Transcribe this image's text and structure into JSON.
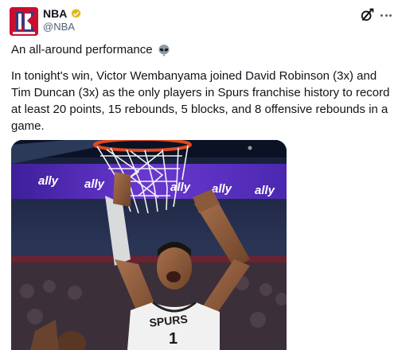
{
  "post": {
    "author": {
      "display_name": "NBA",
      "handle": "@NBA",
      "verified": true,
      "avatar_lettering": "NBA"
    },
    "text_line1": "An all-around performance",
    "text_body": "In tonight's win, Victor Wembanyama joined David Robinson (3x) and Tim Duncan (3x) as the only players in Spurs franchise history to record at least 20 points, 15 rebounds, 5 blocks, and 8 offensive rebounds in a game.",
    "emoji": "alien-icon",
    "media": {
      "jersey_text": "SPURS",
      "jersey_number": "1",
      "arena_banner_text": "ally"
    }
  },
  "icons": {
    "grok": "grok-icon",
    "more": "more-icon",
    "verified": "verified-badge-icon"
  },
  "colors": {
    "verified_gold": "#e2b719",
    "text_primary": "#0f1419",
    "text_secondary": "#536471",
    "avatar_red": "#c8102e",
    "arena_banner": "#5b2bb8"
  }
}
